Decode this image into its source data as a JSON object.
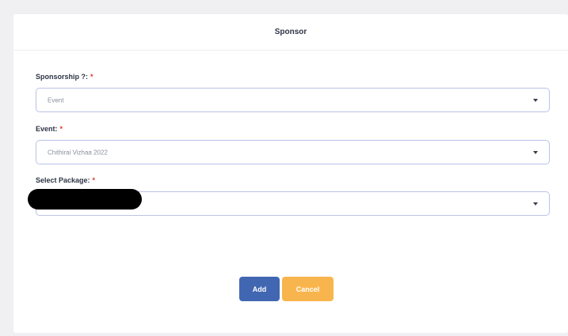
{
  "header": {
    "title": "Sponsor"
  },
  "form": {
    "sponsorship": {
      "label": "Sponsorship ?:",
      "required_mark": "*",
      "value": "Event"
    },
    "event": {
      "label": "Event:",
      "required_mark": "*",
      "value": "Chithirai Vizhaa 2022"
    },
    "package": {
      "label": "Select Package:",
      "required_mark": "*",
      "value": ""
    }
  },
  "actions": {
    "add_label": "Add",
    "cancel_label": "Cancel"
  },
  "colors": {
    "primary": "#4267b2",
    "warning": "#f9b54d",
    "required": "#e3342f",
    "input_border": "#b9c3e6"
  },
  "icons": {
    "dropdown": "caret-down-icon"
  }
}
